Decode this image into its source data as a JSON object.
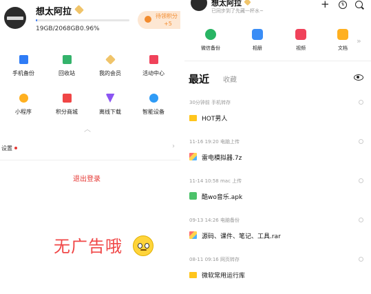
{
  "left": {
    "username": "想太阿拉",
    "storage": {
      "text": "19GB/2068GB",
      "percent": "0.96%",
      "used_fraction": 0.0096
    },
    "points": {
      "label": "待领积分",
      "value": "+5"
    },
    "grid": [
      {
        "label": "手机备份",
        "color": "#2f7cf6"
      },
      {
        "label": "回收站",
        "color": "#34b36b"
      },
      {
        "label": "我的会员",
        "color": "#f0c46a"
      },
      {
        "label": "活动中心",
        "color": "#f0425a"
      },
      {
        "label": "小程序",
        "color": "#ffb020"
      },
      {
        "label": "积分商城",
        "color": "#f04646"
      },
      {
        "label": "离线下载",
        "color": "#8b55f2"
      },
      {
        "label": "智能设备",
        "color": "#2f9bf6"
      }
    ],
    "setting": {
      "label": "设置"
    },
    "logout": "退出登录",
    "slogan": "无广告哦"
  },
  "right": {
    "username": "想太阿拉",
    "subtitle": "已同步到了先藏一杯水~",
    "quick_access": [
      {
        "label": "微信备份",
        "color": "#28b463"
      },
      {
        "label": "相册",
        "color": "#3a8df6"
      },
      {
        "label": "视频",
        "color": "#f0425a"
      },
      {
        "label": "文档",
        "color": "#ffb020"
      }
    ],
    "tabs": {
      "recent": "最近",
      "favorite": "收藏"
    },
    "files": [
      {
        "meta": "30分钟前 手机转存",
        "name": "HOT男人",
        "type": "folder"
      },
      {
        "meta": "11-16 19:20 电脑上传",
        "name": "雷电模拟器.7z",
        "type": "zip"
      },
      {
        "meta": "11-14 10:58 mac 上传",
        "name": "酷wo音乐.apk",
        "type": "apk"
      },
      {
        "meta": "09-13 14:26 电脑备份",
        "name": "源码、课件、笔记、工具.rar",
        "type": "zip"
      },
      {
        "meta": "08-11 09:16 网页转存",
        "name": "微软常用运行库",
        "type": "folder"
      }
    ]
  }
}
